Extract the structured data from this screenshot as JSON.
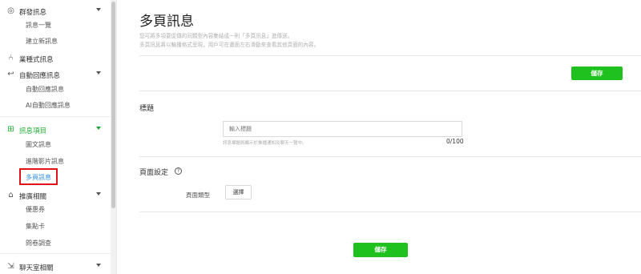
{
  "sidebar": {
    "groups": [
      {
        "label": "群發訊息",
        "icon": "broadcast-icon",
        "children": [
          "訊息一覽",
          "建立新訊息"
        ]
      },
      {
        "label": "業種式訊息",
        "icon": "segment-icon",
        "children": []
      },
      {
        "label": "自動回應訊息",
        "icon": "reply-icon",
        "children": [
          "自動回應訊息",
          "AI自動回應訊息"
        ]
      },
      {
        "label": "訊息項目",
        "icon": "message-item-icon",
        "active": true,
        "children": [
          "圖文訊息",
          "進階影片訊息",
          "多頁訊息"
        ]
      },
      {
        "label": "推廣相關",
        "icon": "store-icon",
        "children": [
          "優惠券",
          "集點卡",
          "問卷調查"
        ]
      },
      {
        "label": "聊天室相關",
        "icon": "chat-icon",
        "children": []
      }
    ],
    "selected_item": "多頁訊息"
  },
  "page": {
    "title": "多頁訊息",
    "description_line1": "您可將多項要促傳的同類型內容集結成一則「多頁訊息」進傳送。",
    "description_line2": "多頁訊息將以輪播格式呈現，用戶可在畫面左右滑動來查看其他頁面的內容。",
    "save_label": "儲存"
  },
  "title_section": {
    "label": "標題",
    "input_placeholder": "輸入標題",
    "hint": "訊息標題將顯示於推播通知及聊天一覽中。",
    "counter": "0/100"
  },
  "page_settings": {
    "label": "頁面設定",
    "help_icon": "question-circle-icon",
    "field_label": "頁面類型",
    "select_label": "選擇"
  },
  "colors": {
    "accent_green": "#1ec11e",
    "active_nav": "#1ea832",
    "selected_link": "#2e8de0",
    "highlight_red": "#e0121a"
  }
}
